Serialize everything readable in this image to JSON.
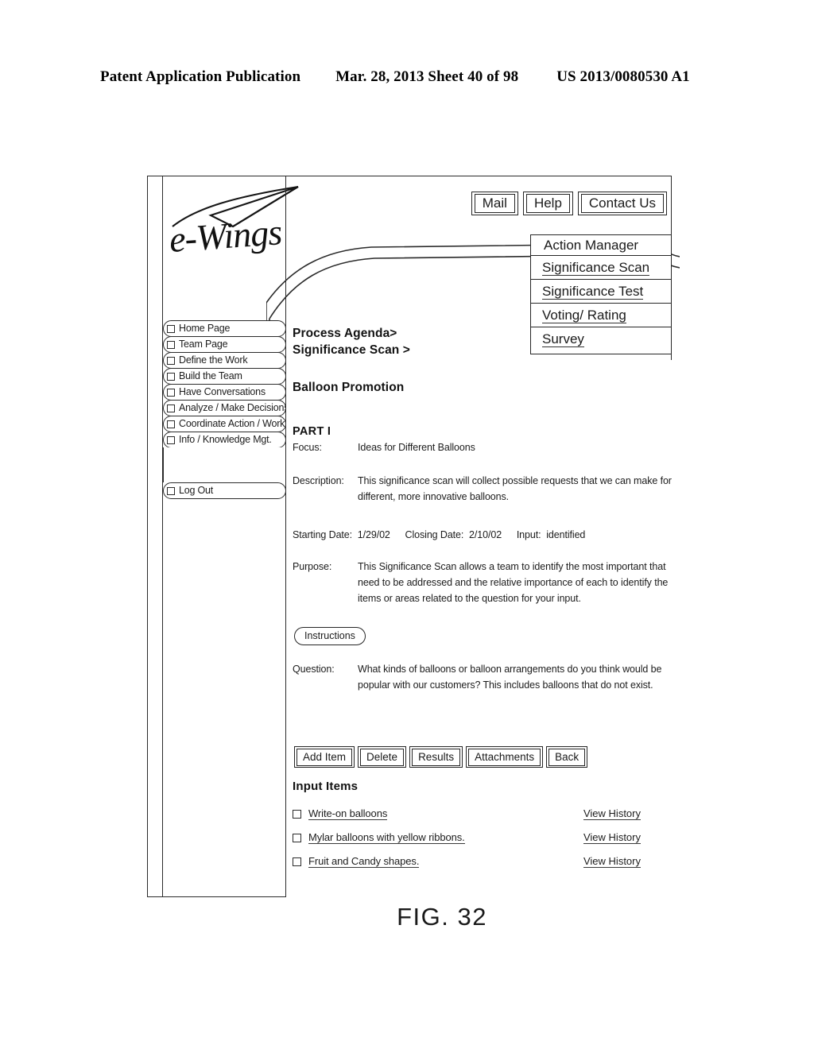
{
  "patent_header": {
    "left": "Patent Application Publication",
    "middle": "Mar. 28, 2013  Sheet 40 of 98",
    "right": "US 2013/0080530 A1"
  },
  "figure_caption": "FIG. 32",
  "app": {
    "logo_text": "e-Wings",
    "utility_buttons": [
      {
        "label": "Mail",
        "name": "mail-button"
      },
      {
        "label": "Help",
        "name": "help-button"
      },
      {
        "label": "Contact Us",
        "name": "contact-us-button"
      }
    ],
    "right_nav": {
      "header": "Action Manager",
      "items": [
        {
          "label": "Significance Scan"
        },
        {
          "label": "Significance Test"
        },
        {
          "label": "Voting/ Rating"
        },
        {
          "label": "Survey"
        }
      ]
    },
    "sidebar": {
      "items": [
        {
          "label": "Home Page"
        },
        {
          "label": "Team Page"
        },
        {
          "label": "Define the Work"
        },
        {
          "label": "Build the Team"
        },
        {
          "label": "Have Conversations"
        },
        {
          "label": "Analyze / Make Decisions"
        },
        {
          "label": "Coordinate Action / Workflow"
        },
        {
          "label": "Info / Knowledge Mgt."
        }
      ],
      "logout": {
        "label": "Log Out"
      }
    },
    "main": {
      "breadcrumb_line1": "Process Agenda>",
      "breadcrumb_line2": "Significance Scan >",
      "title": "Balloon Promotion",
      "part_label": "PART I",
      "focus_key": "Focus:",
      "focus_value": "Ideas for Different Balloons",
      "description_key": "Description:",
      "description_value": "This significance scan will collect possible requests that we can make for different, more innovative balloons.",
      "starting_date_key": "Starting Date:",
      "starting_date_value": "1/29/02",
      "closing_date_key": "Closing Date:",
      "closing_date_value": "2/10/02",
      "input_key": "Input:",
      "input_value": "identified",
      "purpose_key": "Purpose:",
      "purpose_value": "This Significance Scan allows a team to identify the most important that need to be addressed and the relative importance of each to identify the items or areas related to the question for your input.",
      "instructions_button": "Instructions",
      "question_key": "Question:",
      "question_value": "What kinds of balloons or balloon arrangements do you think would be popular with our customers? This includes balloons that do not exist.",
      "action_buttons": [
        {
          "label": "Add Item",
          "name": "add-item-button"
        },
        {
          "label": "Delete",
          "name": "delete-button"
        },
        {
          "label": "Results",
          "name": "results-button"
        },
        {
          "label": "Attachments",
          "name": "attachments-button"
        },
        {
          "label": "Back",
          "name": "back-button"
        }
      ],
      "input_items_heading": "Input Items",
      "input_items": [
        {
          "label": "Write-on balloons",
          "history": "View History"
        },
        {
          "label": "Mylar balloons with yellow ribbons.",
          "history": "View History"
        },
        {
          "label": "Fruit and Candy shapes.",
          "history": "View History"
        }
      ]
    }
  },
  "colors": {
    "ink": "#1a1a1a",
    "line": "#2a2a2a",
    "paper": "#ffffff"
  }
}
